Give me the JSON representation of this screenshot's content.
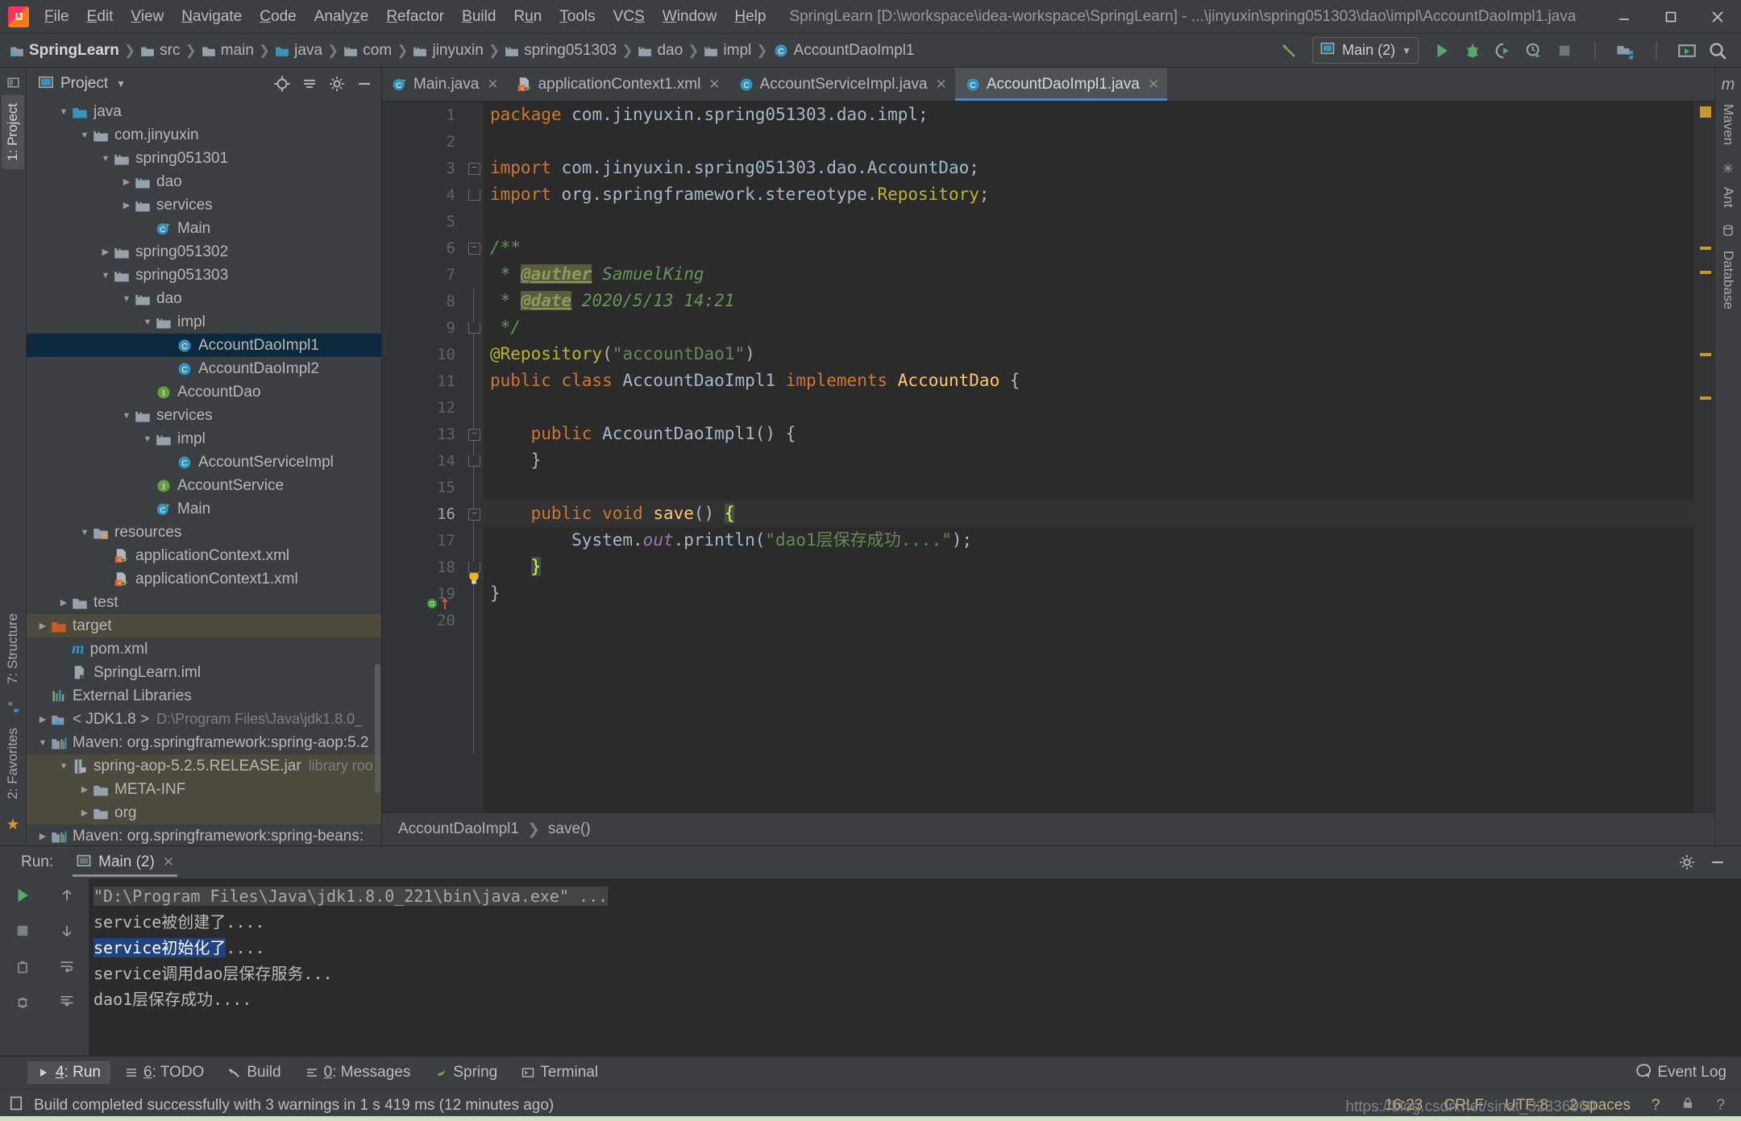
{
  "window": {
    "title": "SpringLearn [D:\\workspace\\idea-workspace\\SpringLearn] - ...\\jinyuxin\\spring051303\\dao\\impl\\AccountDaoImpl1.java",
    "logo_alt": "intellij-idea-logo"
  },
  "menu": [
    {
      "label": "File"
    },
    {
      "label": "Edit"
    },
    {
      "label": "View"
    },
    {
      "label": "Navigate"
    },
    {
      "label": "Code"
    },
    {
      "label": "Analyze"
    },
    {
      "label": "Refactor"
    },
    {
      "label": "Build"
    },
    {
      "label": "Run"
    },
    {
      "label": "Tools"
    },
    {
      "label": "VCS"
    },
    {
      "label": "Window"
    },
    {
      "label": "Help"
    }
  ],
  "breadcrumb": [
    {
      "label": "SpringLearn",
      "icon": "module-icon"
    },
    {
      "label": "src",
      "icon": "folder-icon"
    },
    {
      "label": "main",
      "icon": "folder-icon"
    },
    {
      "label": "java",
      "icon": "source-folder-icon"
    },
    {
      "label": "com",
      "icon": "package-icon"
    },
    {
      "label": "jinyuxin",
      "icon": "package-icon"
    },
    {
      "label": "spring051303",
      "icon": "package-icon"
    },
    {
      "label": "dao",
      "icon": "package-icon"
    },
    {
      "label": "impl",
      "icon": "package-icon"
    },
    {
      "label": "AccountDaoImpl1",
      "icon": "class-icon"
    }
  ],
  "run_config": {
    "name": "Main (2)",
    "icon": "run-config-icon"
  },
  "project_panel": {
    "title": "Project",
    "tree": [
      {
        "label": "java",
        "indent": 2,
        "arrow": "down",
        "icon": "source-folder-icon",
        "state": "normal"
      },
      {
        "label": "com.jinyuxin",
        "indent": 3,
        "arrow": "down",
        "icon": "package-icon",
        "state": "normal"
      },
      {
        "label": "spring051301",
        "indent": 4,
        "arrow": "down",
        "icon": "package-icon",
        "state": "normal"
      },
      {
        "label": "dao",
        "indent": 5,
        "arrow": "right",
        "icon": "package-icon",
        "state": "normal"
      },
      {
        "label": "services",
        "indent": 5,
        "arrow": "right",
        "icon": "package-icon",
        "state": "normal"
      },
      {
        "label": "Main",
        "indent": 6,
        "arrow": "none",
        "icon": "runnable-class-icon",
        "state": "normal"
      },
      {
        "label": "spring051302",
        "indent": 4,
        "arrow": "right",
        "icon": "package-icon",
        "state": "normal"
      },
      {
        "label": "spring051303",
        "indent": 4,
        "arrow": "down",
        "icon": "package-icon",
        "state": "normal"
      },
      {
        "label": "dao",
        "indent": 5,
        "arrow": "down",
        "icon": "package-icon",
        "state": "normal"
      },
      {
        "label": "impl",
        "indent": 6,
        "arrow": "down",
        "icon": "package-icon",
        "state": "normal"
      },
      {
        "label": "AccountDaoImpl1",
        "indent": 7,
        "arrow": "none",
        "icon": "class-icon",
        "state": "selected"
      },
      {
        "label": "AccountDaoImpl2",
        "indent": 7,
        "arrow": "none",
        "icon": "class-icon",
        "state": "normal"
      },
      {
        "label": "AccountDao",
        "indent": 6,
        "arrow": "none",
        "icon": "interface-icon",
        "state": "normal"
      },
      {
        "label": "services",
        "indent": 5,
        "arrow": "down",
        "icon": "package-icon",
        "state": "normal"
      },
      {
        "label": "impl",
        "indent": 6,
        "arrow": "down",
        "icon": "package-icon",
        "state": "normal"
      },
      {
        "label": "AccountServiceImpl",
        "indent": 7,
        "arrow": "none",
        "icon": "class-icon",
        "state": "normal"
      },
      {
        "label": "AccountService",
        "indent": 6,
        "arrow": "none",
        "icon": "interface-icon",
        "state": "normal"
      },
      {
        "label": "Main",
        "indent": 6,
        "arrow": "none",
        "icon": "runnable-class-icon",
        "state": "normal"
      },
      {
        "label": "resources",
        "indent": 3,
        "arrow": "down",
        "icon": "resource-folder-icon",
        "state": "normal"
      },
      {
        "label": "applicationContext.xml",
        "indent": 4,
        "arrow": "none",
        "icon": "spring-xml-icon",
        "state": "normal"
      },
      {
        "label": "applicationContext1.xml",
        "indent": 4,
        "arrow": "none",
        "icon": "spring-xml-icon",
        "state": "normal"
      },
      {
        "label": "test",
        "indent": 2,
        "arrow": "right",
        "icon": "folder-icon",
        "state": "normal"
      },
      {
        "label": "target",
        "indent": 1,
        "arrow": "right",
        "icon": "excluded-folder-icon",
        "state": "highlighted"
      },
      {
        "label": "pom.xml",
        "indent": 2,
        "arrow": "none",
        "icon": "maven-icon",
        "state": "normal"
      },
      {
        "label": "SpringLearn.iml",
        "indent": 2,
        "arrow": "none",
        "icon": "iml-icon",
        "state": "normal"
      },
      {
        "label": "External Libraries",
        "indent": 1,
        "arrow": "none",
        "icon": "libraries-icon",
        "state": "normal"
      },
      {
        "label": "< JDK1.8 >",
        "sub": "D:\\Program Files\\Java\\jdk1.8.0_",
        "indent": 1,
        "arrow": "right",
        "icon": "jdk-icon",
        "state": "normal"
      },
      {
        "label": "Maven: org.springframework:spring-aop:5.2",
        "indent": 1,
        "arrow": "down",
        "icon": "maven-lib-icon",
        "state": "normal"
      },
      {
        "label": "spring-aop-5.2.5.RELEASE.jar",
        "sub": "library roo",
        "indent": 2,
        "arrow": "down",
        "icon": "jar-icon",
        "state": "highlighted"
      },
      {
        "label": "META-INF",
        "indent": 3,
        "arrow": "right",
        "icon": "folder-icon",
        "state": "highlighted"
      },
      {
        "label": "org",
        "indent": 3,
        "arrow": "right",
        "icon": "folder-icon",
        "state": "highlighted"
      },
      {
        "label": "Maven: org.springframework:spring-beans:",
        "indent": 1,
        "arrow": "right",
        "icon": "maven-lib-icon",
        "state": "normal"
      }
    ]
  },
  "left_strip": [
    {
      "label": "1: Project",
      "selected": true
    },
    {
      "label": "7: Structure",
      "selected": false
    },
    {
      "label": "2: Favorites",
      "selected": false
    }
  ],
  "right_strip": [
    {
      "label": "Maven",
      "icon": "maven-icon"
    },
    {
      "label": "Ant",
      "icon": "ant-icon"
    },
    {
      "label": "Database",
      "icon": "database-icon"
    }
  ],
  "editor_tabs": [
    {
      "label": "Main.java",
      "icon": "runnable-class-icon",
      "active": false
    },
    {
      "label": "applicationContext1.xml",
      "icon": "spring-xml-icon",
      "active": false
    },
    {
      "label": "AccountServiceImpl.java",
      "icon": "class-icon",
      "active": false
    },
    {
      "label": "AccountDaoImpl1.java",
      "icon": "class-icon",
      "active": true
    }
  ],
  "editor": {
    "current_line": 16,
    "line_numbers": [
      1,
      2,
      3,
      4,
      5,
      6,
      7,
      8,
      9,
      10,
      11,
      12,
      13,
      14,
      15,
      16,
      17,
      18,
      19,
      20
    ],
    "code_lines": [
      "package com.jinyuxin.spring051303.dao.impl;",
      "",
      "import com.jinyuxin.spring051303.dao.AccountDao;",
      "import org.springframework.stereotype.Repository;",
      "",
      "/**",
      " * @auther SamuelKing",
      " * @date 2020/5/13 14:21",
      " */",
      "@Repository(\"accountDao1\")",
      "public class AccountDaoImpl1 implements AccountDao {",
      "",
      "    public AccountDaoImpl1() {",
      "    }",
      "",
      "    public void save() {",
      "        System.out.println(\"dao1层保存成功....\");",
      "    }",
      "}",
      ""
    ]
  },
  "editor_breadcrumb": [
    {
      "label": "AccountDaoImpl1"
    },
    {
      "label": "save()"
    }
  ],
  "run_window": {
    "label": "Run:",
    "tab": "Main (2)",
    "console_lines": [
      {
        "text": "\"D:\\Program Files\\Java\\jdk1.8.0_221\\bin\\java.exe\" ...",
        "style": "command"
      },
      {
        "text": "service被创建了....",
        "style": "normal"
      },
      {
        "text": "service初始化了....",
        "style": "selected",
        "selected_part": "service初始化了",
        "rest": "...."
      },
      {
        "text": "service调用dao层保存服务...",
        "style": "normal"
      },
      {
        "text": "dao1层保存成功....",
        "style": "normal"
      }
    ]
  },
  "bottom_toolbar": [
    {
      "label": "4: Run",
      "icon": "run-icon",
      "selected": true
    },
    {
      "label": "6: TODO",
      "icon": "todo-icon",
      "selected": false
    },
    {
      "label": "Build",
      "icon": "build-icon",
      "selected": false
    },
    {
      "label": "0: Messages",
      "icon": "messages-icon",
      "selected": false
    },
    {
      "label": "Spring",
      "icon": "spring-icon",
      "selected": false
    },
    {
      "label": "Terminal",
      "icon": "terminal-icon",
      "selected": false
    }
  ],
  "event_log": {
    "label": "Event Log",
    "icon": "event-log-icon"
  },
  "status_bar": {
    "message": "Build completed successfully with 3 warnings in 1 s 419 ms (12 minutes ago)",
    "time": "16:23",
    "line_sep": "CRLF",
    "encoding": "UTF-8",
    "indent": "2 spaces",
    "branch": "?",
    "watermark": "https://blog.csdn.net/sinat_32336960"
  },
  "colors": {
    "accent": "#4a88c7",
    "selection": "#0d293e",
    "keyword": "#cc7832",
    "string": "#6a8759",
    "comment": "#629755",
    "annotation": "#bbb529",
    "editor_bg": "#2b2b2b",
    "panel_bg": "#3c3f41"
  }
}
